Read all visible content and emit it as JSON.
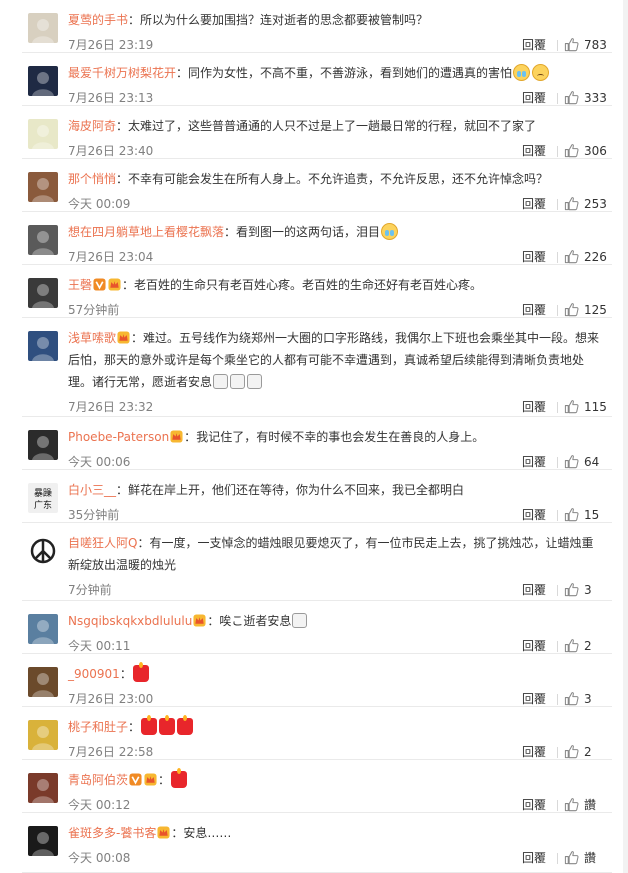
{
  "colors": {
    "accent": "#eb7350",
    "meta": "#808080",
    "divider": "#eaeaea"
  },
  "icons": {
    "like": "thumbs-up-icon",
    "vip": "vip-v-icon",
    "member": "member-crown-icon"
  },
  "comments": [
    {
      "user": "夏莺的手书",
      "badges": [],
      "sep": "：",
      "parts": [
        {
          "t": "所以为什么要加围挡？连对逝者的思念都要被管制吗？"
        }
      ],
      "time": "7月26日 23:19",
      "reply": "回覆",
      "likes": "783",
      "avatar": "#d8d0c0"
    },
    {
      "user": "最爱千树万树梨花开",
      "badges": [],
      "sep": "：",
      "parts": [
        {
          "t": "同作为女性，不高不重，不善游泳，看到她们的遭遇真的害怕"
        },
        {
          "e": "cry"
        },
        {
          "e": "sad"
        }
      ],
      "time": "7月26日 23:13",
      "reply": "回覆",
      "likes": "333",
      "avatar": "#1f2a44"
    },
    {
      "user": "海皮阿奇",
      "badges": [],
      "sep": "：",
      "parts": [
        {
          "t": "太难过了，这些普普通通的人只不过是上了一趟最日常的行程，就回不了家了"
        }
      ],
      "time": "7月26日 23:40",
      "reply": "回覆",
      "likes": "306",
      "avatar": "#e8e8c8"
    },
    {
      "user": "那个悄悄",
      "badges": [],
      "sep": "：",
      "parts": [
        {
          "t": "不幸有可能会发生在所有人身上。不允许追责，不允许反思，还不允许悼念吗？"
        }
      ],
      "time": "今天 00:09",
      "reply": "回覆",
      "likes": "253",
      "avatar": "#8a5a3c"
    },
    {
      "user": "想在四月躺草地上看樱花飘落",
      "badges": [],
      "sep": "：",
      "parts": [
        {
          "t": "看到图一的这两句话，泪目"
        },
        {
          "e": "cry"
        }
      ],
      "time": "7月26日 23:04",
      "reply": "回覆",
      "likes": "226",
      "avatar": "#5a5a5a"
    },
    {
      "user": "王磬",
      "badges": [
        "vip",
        "member"
      ],
      "sep": "：",
      "parts": [
        {
          "t": "老百姓的生命只有老百姓心疼。老百姓的生命还好有老百姓心疼。"
        }
      ],
      "time": "57分钟前",
      "reply": "回覆",
      "likes": "125",
      "avatar": "#3a3a3a"
    },
    {
      "user": "浅草嗦歌",
      "badges": [
        "member"
      ],
      "sep": "：",
      "parts": [
        {
          "t": "难过。五号线作为绕郑州一大圈的口字形路线，我偶尔上下班也会乘坐其中一段。想来后怕，那天的意外或许是每个乘坐它的人都有可能不幸遭遇到，真诚希望后续能得到清晰负责地处理。诸行无常，愿逝者安息"
        },
        {
          "e": "pray"
        },
        {
          "e": "pray"
        },
        {
          "e": "pray"
        }
      ],
      "time": "7月26日 23:32",
      "reply": "回覆",
      "likes": "115",
      "avatar": "#2f4f7f"
    },
    {
      "user": "Phoebe-Paterson",
      "badges": [
        "member"
      ],
      "sep": "：",
      "parts": [
        {
          "t": "我记住了，有时候不幸的事也会发生在善良的人身上。"
        }
      ],
      "time": "今天 00:06",
      "reply": "回覆",
      "likes": "64",
      "avatar": "#2b2b2b"
    },
    {
      "user": "白小三__",
      "badges": [],
      "sep": "：",
      "parts": [
        {
          "t": "鲜花在岸上开，他们还在等待，你为什么不回来，我已全都明白"
        }
      ],
      "time": "35分钟前",
      "reply": "回覆",
      "likes": "15",
      "avatar": "#f0f0f0",
      "avatar_text": "暴躁广东"
    },
    {
      "user": "自嗟狂人阿Q",
      "badges": [],
      "sep": "：",
      "parts": [
        {
          "t": "有一度，一支悼念的蜡烛眼见要熄灭了，有一位市民走上去，挑了挑烛芯，让蜡烛重新绽放出温暖的烛光"
        }
      ],
      "time": "7分钟前",
      "reply": "回覆",
      "likes": "3",
      "avatar": "#ffffff",
      "avatar_peace": true
    },
    {
      "user": "Nsgqibskqkxbdlululu",
      "badges": [
        "member"
      ],
      "sep": "：",
      "parts": [
        {
          "t": "唉こ逝者安息"
        },
        {
          "e": "pray"
        }
      ],
      "time": "今天 00:11",
      "reply": "回覆",
      "likes": "2",
      "avatar": "#5a7fa0"
    },
    {
      "user": "_900901",
      "badges": [],
      "sep": "：",
      "parts": [
        {
          "e": "candle"
        }
      ],
      "time": "7月26日 23:00",
      "reply": "回覆",
      "likes": "3",
      "avatar": "#6b4a2b"
    },
    {
      "user": "桃子和肚子",
      "badges": [],
      "sep": "：",
      "parts": [
        {
          "e": "candle"
        },
        {
          "e": "candle"
        },
        {
          "e": "candle"
        }
      ],
      "time": "7月26日 22:58",
      "reply": "回覆",
      "likes": "2",
      "avatar": "#d9b23a"
    },
    {
      "user": "青岛阿伯茨",
      "badges": [
        "vip",
        "member"
      ],
      "sep": "：",
      "parts": [
        {
          "e": "candle"
        }
      ],
      "time": "今天 00:12",
      "reply": "回覆",
      "likes": "讚",
      "avatar": "#7a3a2a"
    },
    {
      "user": "雀斑多多-饕书客",
      "badges": [
        "member"
      ],
      "sep": "：",
      "parts": [
        {
          "t": "安息……"
        }
      ],
      "time": "今天 00:08",
      "reply": "回覆",
      "likes": "讚",
      "avatar": "#1a1a1a"
    }
  ]
}
